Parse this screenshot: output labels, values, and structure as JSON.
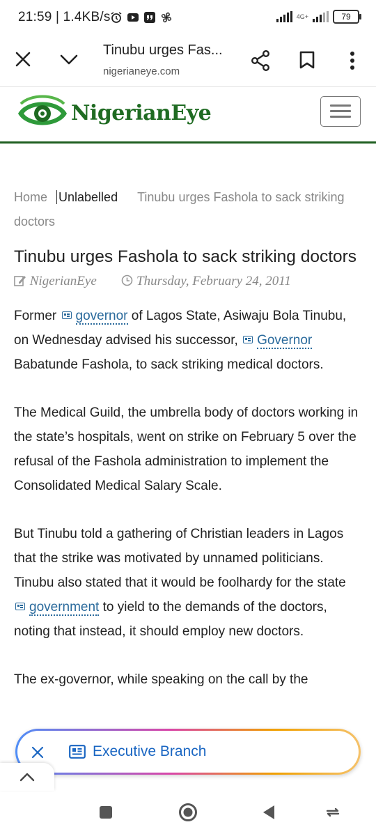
{
  "status_bar": {
    "time": "21:59",
    "speed": "1.4KB/s",
    "network": "4G+",
    "battery": "79",
    "icons": [
      "alarm-icon",
      "youtube-icon",
      "quotes-app-icon",
      "fan-icon"
    ]
  },
  "tab_bar": {
    "title": "Tinubu urges Fas...",
    "url": "nigerianeye.com",
    "icons": [
      "close-icon",
      "chevron-down-icon",
      "share-icon",
      "bookmark-icon",
      "more-vert-icon"
    ]
  },
  "site": {
    "logo": "NigerianEye",
    "logo_icon": "eye-logo-icon",
    "menu_icon": "hamburger-icon",
    "brand_color": "#1f6b22"
  },
  "breadcrumb": {
    "home": "Home",
    "category": "Unlabelled",
    "current": "Tinubu urges Fashola to sack striking doctors"
  },
  "article": {
    "title": "Tinubu urges Fashola to sack striking doctors",
    "author": "NigerianEye",
    "date": "Thursday, February 24, 2011",
    "p1": {
      "a": "Former ",
      "kw1": "governor",
      "b": " of Lagos State, Asiwaju Bola Tinubu, on Wednesday advised his successor, ",
      "kw2": "Governor",
      "c": " Babatunde Fashola, to sack striking medical doctors."
    },
    "p2": "The Medical Guild, the umbrella body of doctors working in the state’s hospitals, went on strike on February 5 over the refusal of the Fashola administration to implement the Consolidated Medical Salary Scale.",
    "p3": {
      "a": "But Tinubu told a gathering of Christian leaders in Lagos that the strike was motivated by unnamed politicians. Tinubu also stated that it would be foolhardy for the state ",
      "kw": "government",
      "b": " to yield to the demands of the doctors, noting that instead, it should employ new doctors."
    },
    "p4": "The ex-governor, while speaking on the call by the"
  },
  "chip": {
    "label": "Executive Branch",
    "close_icon": "close-icon",
    "icon": "newspaper-icon"
  },
  "nav_bar": {
    "icons": [
      "recents-square-icon",
      "home-circle-icon",
      "back-triangle-icon",
      "rotate-icon"
    ]
  }
}
